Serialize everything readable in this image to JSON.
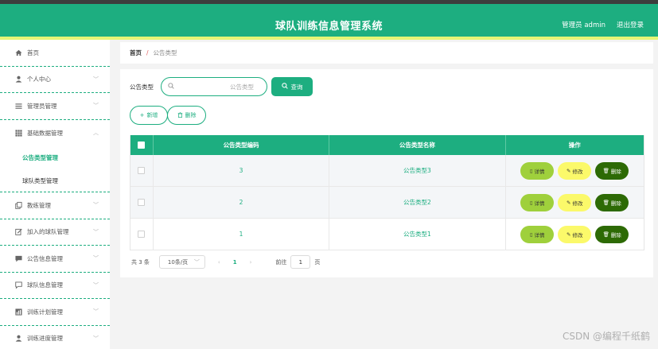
{
  "header": {
    "title": "球队训练信息管理系统",
    "user": "管理员 admin",
    "logout": "退出登录",
    "color": "#1dae80"
  },
  "sidebar": {
    "items": [
      {
        "label": "首页",
        "icon": "home-icon"
      },
      {
        "label": "个人中心",
        "icon": "user-icon"
      },
      {
        "label": "管理员管理",
        "icon": "list-icon"
      },
      {
        "label": "基础数据管理",
        "icon": "grid-icon"
      },
      {
        "label": "教练管理",
        "icon": "copy-icon"
      },
      {
        "label": "加入的球队管理",
        "icon": "edit-icon"
      },
      {
        "label": "公告信息管理",
        "icon": "message-icon"
      },
      {
        "label": "球队信息管理",
        "icon": "chat-icon"
      },
      {
        "label": "训练计划管理",
        "icon": "chart-icon"
      },
      {
        "label": "训练进度管理",
        "icon": "user-icon"
      }
    ],
    "submenu": [
      {
        "label": "公告类型管理",
        "active": true
      },
      {
        "label": "球队类型管理",
        "active": false
      }
    ]
  },
  "breadcrumb": {
    "home": "首页",
    "separator": "/",
    "current": "公告类型"
  },
  "search": {
    "label": "公告类型",
    "placeholder": "公告类型",
    "button": "查询"
  },
  "actions": {
    "add": "新增",
    "delete": "删除"
  },
  "table": {
    "columns": [
      "公告类型编码",
      "公告类型名称",
      "操作"
    ],
    "rows": [
      {
        "code": "3",
        "name": "公告类型3"
      },
      {
        "code": "2",
        "name": "公告类型2"
      },
      {
        "code": "1",
        "name": "公告类型1"
      }
    ],
    "ops": {
      "detail": "详情",
      "edit": "修改",
      "remove": "删除"
    }
  },
  "pager": {
    "total": "共 3 条",
    "page_size": "10条/页",
    "current_page": "1",
    "goto_label": "前往",
    "goto_value": "1",
    "unit": "页"
  },
  "watermark": "CSDN @编程千纸鹤"
}
